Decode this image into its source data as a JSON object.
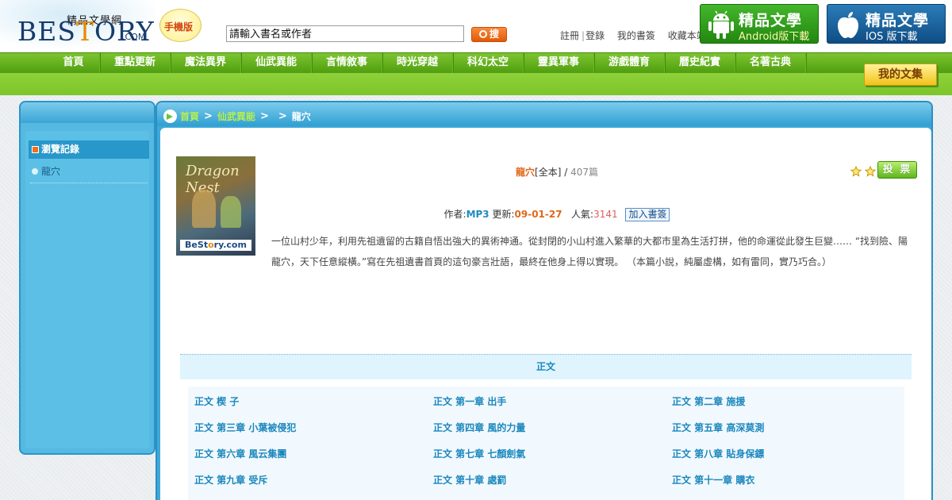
{
  "header": {
    "logo_cn": "精品文學網",
    "logo_en_a": "BES",
    "logo_en_o": "T",
    "logo_en_b": "ORY",
    "logo_com": ".COM",
    "mobile_badge": "手機版",
    "search_value": "請輸入書名或作者",
    "search_button": "搜",
    "links": {
      "register": "註冊",
      "login": "登錄",
      "my_bookshelf": "我的書簽",
      "bookmark_site": "收藏本站"
    },
    "android": {
      "title": "精品文學",
      "subtitle": "Android版下載"
    },
    "ios": {
      "title": "精品文學",
      "subtitle": "IOS 版下載"
    }
  },
  "nav": {
    "items": [
      "首頁",
      "重點更新",
      "魔法異界",
      "仙武異能",
      "言情敘事",
      "時光穿越",
      "科幻太空",
      "靈異軍事",
      "游戲體育",
      "曆史紀實",
      "名著古典"
    ],
    "my_collection": "我的文集"
  },
  "sidebar": {
    "history_title": "瀏覽記錄",
    "history_items": [
      "龍穴"
    ]
  },
  "breadcrumb": {
    "home": "首頁",
    "category": "仙武異能",
    "sep": ">",
    "current": "龍穴"
  },
  "book": {
    "cover_title": "Dragon Nest",
    "cover_brand_a": "BeSt",
    "cover_brand_o": "o",
    "cover_brand_b": "ry.com",
    "name": "龍穴",
    "status": "[全本]",
    "slash": " / ",
    "count": "407篇",
    "vote": "投 票",
    "author_label": "作者:",
    "author": "MP3",
    "update_label": "更新:",
    "update": "09-01-27",
    "pop_label": "人氣:",
    "pop": "3141",
    "add_bookmark": "加入書簽",
    "synopsis": "一位山村少年，利用先祖遺留的古籍自悟出強大的異術神通。從封閉的小山村進入繁華的大都市里為生活打拼，他的命運從此發生巨變…… “找到險、陽龍穴，天下任意縱橫。”寫在先祖遺書首頁的這句豪言壯語，最終在他身上得以實現。 （本篇小說，純屬虛構，如有雷同，實乃巧合。）",
    "rating_stars": 2
  },
  "chapters": {
    "section_title": "正文",
    "rows": [
      [
        "正文 楔 子",
        "正文 第一章 出手",
        "正文 第二章 施援"
      ],
      [
        "正文 第三章 小葉被侵犯",
        "正文 第四章 風的力量",
        "正文 第五章 高深莫測"
      ],
      [
        "正文 第六章 風云集團",
        "正文 第七章 七顏劍氣",
        "正文 第八章 貼身保鏢"
      ],
      [
        "正文 第九章 受斥",
        "正文 第十章 處罰",
        "正文 第十一章 購衣"
      ]
    ]
  },
  "colors": {
    "nav_green": "#5fae1c",
    "link_blue": "#1b87bd",
    "accent_orange": "#e0681a",
    "sidebar_blue": "#55b9e1"
  }
}
